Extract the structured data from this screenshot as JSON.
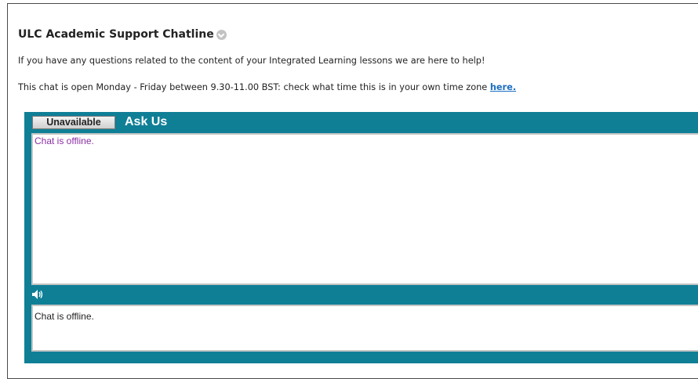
{
  "header": {
    "title": "ULC Academic Support Chatline",
    "line1": "If you have any questions related to the content of your Integrated Learning lessons we are here to help!",
    "line2_prefix": "This chat is open Monday - Friday between 9.30-11.00 BST: check what time this is in your own time zone ",
    "line2_link": "here."
  },
  "chat": {
    "status_button": "Unavailable",
    "title": "Ask Us",
    "transcript_message": "Chat is offline.",
    "input_message": "Chat is offline.",
    "sound_icon": "speaker-icon"
  },
  "colors": {
    "widget_bg": "#0f7f96",
    "transcript_text": "#8a2ea3",
    "link": "#1a6fc2"
  }
}
